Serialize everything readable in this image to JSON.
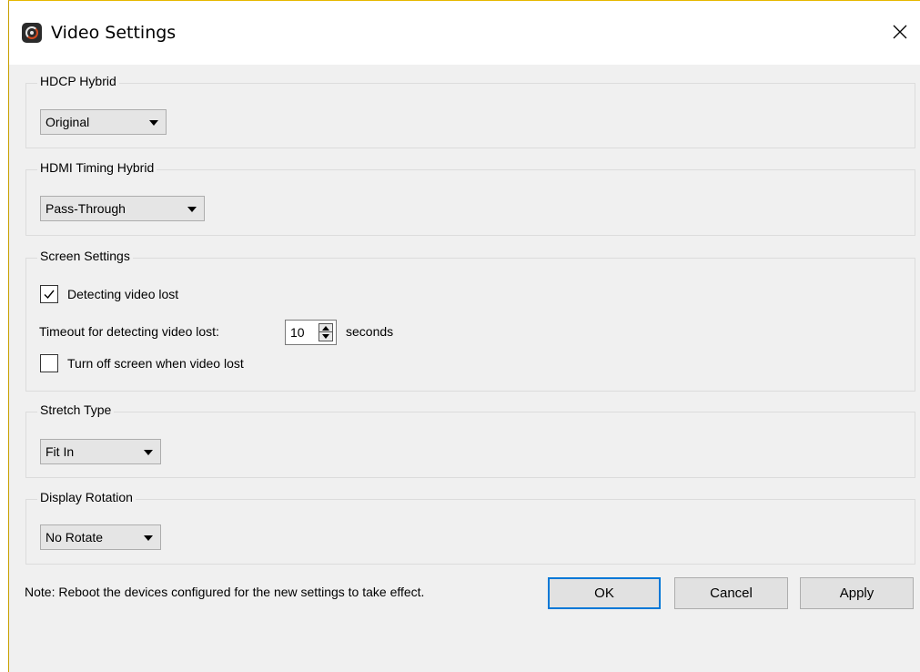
{
  "window": {
    "title": "Video Settings",
    "icon": "app-logo-icon",
    "close_icon": "close-icon"
  },
  "hdcp": {
    "label": "HDCP Hybrid",
    "selected": "Original"
  },
  "hdmi_timing": {
    "label": "HDMI Timing Hybrid",
    "selected": "Pass-Through"
  },
  "screen": {
    "label": "Screen Settings",
    "detect_label": "Detecting video lost",
    "detect_checked": true,
    "timeout_label": "Timeout for detecting video lost:",
    "timeout_value": "10",
    "timeout_unit": "seconds",
    "turnoff_label": "Turn off screen when video lost",
    "turnoff_checked": false
  },
  "stretch": {
    "label": "Stretch Type",
    "selected": "Fit In"
  },
  "rotation": {
    "label": "Display Rotation",
    "selected": "No Rotate"
  },
  "footer": {
    "note": "Note: Reboot the devices configured for the new settings to take effect.",
    "ok": "OK",
    "cancel": "Cancel",
    "apply": "Apply"
  },
  "colors": {
    "accent": "#0078d7",
    "background": "#f0f0f0",
    "titlebar": "#ffffff"
  }
}
